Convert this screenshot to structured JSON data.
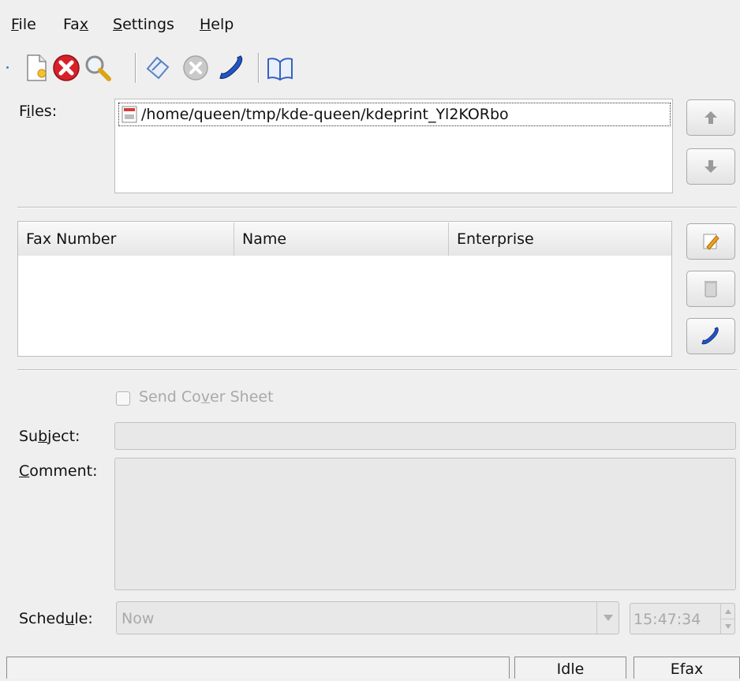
{
  "menu": [
    {
      "pre": "",
      "key": "F",
      "post": "ile"
    },
    {
      "pre": "Fa",
      "key": "x",
      "post": ""
    },
    {
      "pre": "",
      "key": "S",
      "post": "ettings"
    },
    {
      "pre": "",
      "key": "H",
      "post": "elp"
    }
  ],
  "toolbar": {
    "icons": [
      "new-document-icon",
      "stop-icon",
      "preview-icon",
      "erase-icon",
      "cancel-icon",
      "phone-icon",
      "addressbook-icon"
    ]
  },
  "files": {
    "label_pre": "F",
    "label_key": "i",
    "label_post": "les:",
    "items": [
      "/home/queen/tmp/kde-queen/kdeprint_Yl2KORbo"
    ]
  },
  "recipients": {
    "columns": [
      "Fax Number",
      "Name",
      "Enterprise"
    ],
    "rows": []
  },
  "cover_sheet": {
    "pre": "Send Co",
    "key": "v",
    "post": "er Sheet",
    "checked": false
  },
  "subject": {
    "pre": "Su",
    "key": "b",
    "post": "ject:",
    "value": ""
  },
  "comment": {
    "pre": "",
    "key": "C",
    "post": "omment:",
    "value": ""
  },
  "schedule": {
    "pre": "Sched",
    "key": "u",
    "post": "le:",
    "selected": "Now",
    "time": "15:47:34"
  },
  "status": {
    "message": "",
    "state": "Idle",
    "system": "Efax"
  },
  "colors": {
    "background": "#efefef",
    "phone_blue": "#2255c4",
    "stop_red": "#d8202a"
  }
}
